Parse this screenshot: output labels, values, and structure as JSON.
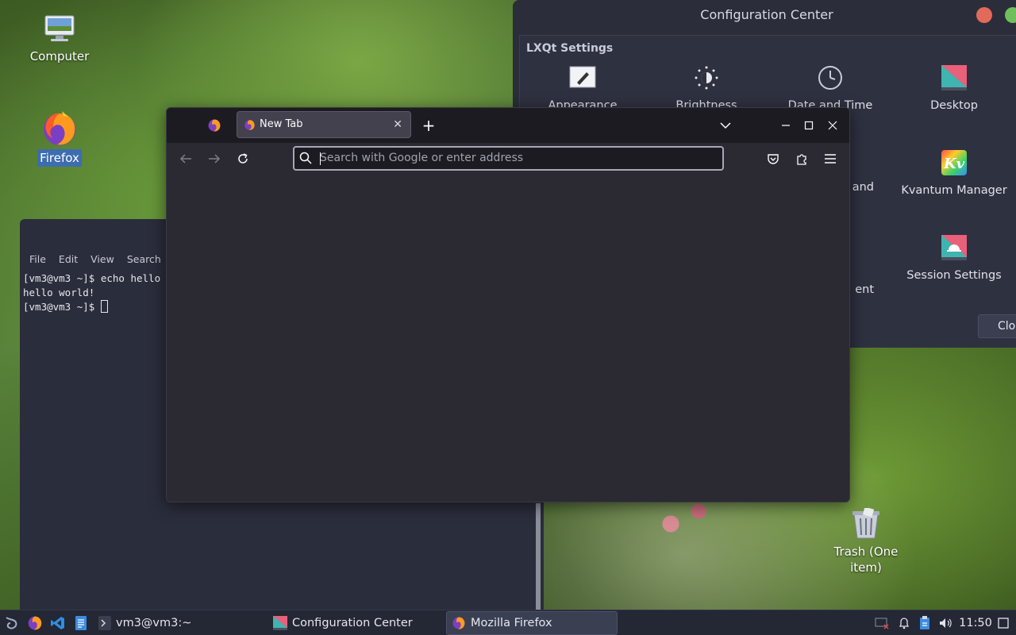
{
  "desktop": {
    "computer_label": "Computer",
    "firefox_label": "Firefox",
    "trash_label_line1": "Trash (One",
    "trash_label_line2": "item)"
  },
  "config_center": {
    "title": "Configuration Center",
    "section": "LXQt Settings",
    "items": {
      "appearance": "Appearance",
      "brightness": "Brightness",
      "date_time": "Date and Time",
      "desktop": "Desktop",
      "partial_and": "and",
      "kvantum": "Kvantum Manager",
      "partial_ent": "ent",
      "session": "Session Settings"
    },
    "close_label": "Clo"
  },
  "terminal": {
    "menu": {
      "file": "File",
      "edit": "Edit",
      "view": "View",
      "search": "Search"
    },
    "line1": "[vm3@vm3 ~]$ echo hello",
    "line2": "hello world!",
    "line3": "[vm3@vm3 ~]$ "
  },
  "firefox": {
    "tab_title": "New Tab",
    "url_placeholder": "Search with Google or enter address",
    "url_value": ""
  },
  "taskbar": {
    "terminal_task": "vm3@vm3:~",
    "config_task": "Configuration Center",
    "firefox_task": "Mozilla Firefox",
    "clock": "11:50"
  },
  "colors": {
    "accent_selection": "#3d6db0",
    "firefox_bg": "#2b2a33",
    "taskbar_bg": "#242734"
  }
}
